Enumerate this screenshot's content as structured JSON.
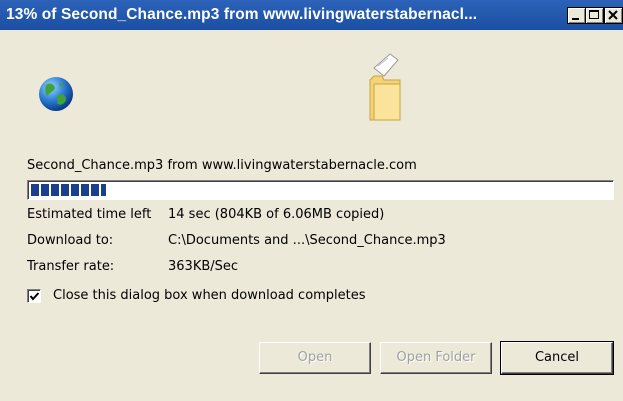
{
  "window": {
    "title": "13% of Second_Chance.mp3 from www.livingwaterstabernacl...",
    "controls": {
      "minimize_icon": "minimize-icon",
      "maximize_icon": "maximize-icon",
      "close_icon": "close-icon"
    }
  },
  "icons": {
    "globe": "globe-icon",
    "folder": "folder-with-document-icon"
  },
  "download": {
    "source_text": "Second_Chance.mp3 from www.livingwaterstabernacle.com",
    "progress_fraction": 0.13,
    "estimated_time_label": "Estimated time left",
    "estimated_time_value": "14 sec (804KB of 6.06MB copied)",
    "download_to_label": "Download to:",
    "download_to_value": "C:\\Documents and ...\\Second_Chance.mp3",
    "transfer_rate_label": "Transfer rate:",
    "transfer_rate_value": "363KB/Sec"
  },
  "options": {
    "close_when_done_label": "Close this dialog box when download completes",
    "close_when_done_checked": true
  },
  "buttons": {
    "open_label": "Open",
    "open_folder_label": "Open Folder",
    "cancel_label": "Cancel"
  },
  "colors": {
    "titlebar": "#1b4fa3",
    "progress_fill": "#1a3f8e",
    "dialog_bg": "#ece9d8"
  }
}
